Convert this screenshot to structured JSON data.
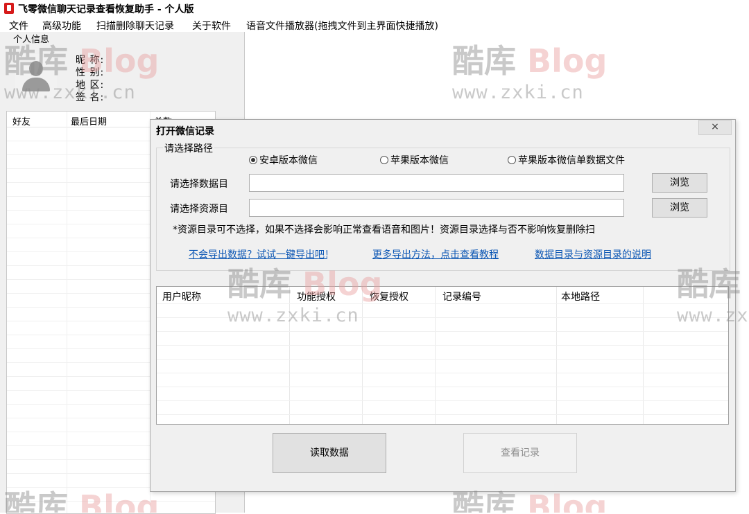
{
  "app": {
    "title": "飞零微信聊天记录查看恢复助手 - 个人版"
  },
  "menu": [
    "文件",
    "高级功能",
    "扫描删除聊天记录",
    "关于软件",
    "语音文件播放器(拖拽文件到主界面快捷播放)"
  ],
  "profile": {
    "group_label": "个人信息",
    "nickname_label": "昵 称:",
    "gender_label": "性 别:",
    "region_label": "地 区:",
    "signature_label": "签 名:"
  },
  "friends_table": {
    "columns": [
      "好友",
      "最后日期",
      "总数"
    ]
  },
  "dialog": {
    "title": "打开微信记录",
    "close_glyph": "×",
    "group_label": "请选择路径",
    "radios": [
      {
        "label": "安卓版本微信",
        "checked": true
      },
      {
        "label": "苹果版本微信",
        "checked": false
      },
      {
        "label": "苹果版本微信单数据文件",
        "checked": false
      }
    ],
    "data_dir_label": "请选择数据目",
    "resource_dir_label": "请选择资源目",
    "data_dir_value": "",
    "resource_dir_value": "",
    "browse_label": "浏览",
    "note": "*资源目录可不选择，如果不选择会影响正常查看语音和图片！资源目录选择与否不影响恢复删除扫",
    "links": [
      "不会导出数据？试试一键导出吧！",
      "更多导出方法，点击查看教程",
      "数据目录与资源目录的说明"
    ],
    "table_columns": [
      "用户昵称",
      "功能授权",
      "恢复授权",
      "记录编号",
      "本地路径"
    ],
    "read_button": "读取数据",
    "view_button": "查看记录"
  },
  "watermark": {
    "brand_cn": "酷库",
    "brand_en": "Blog",
    "url": "www.zxki.cn"
  }
}
